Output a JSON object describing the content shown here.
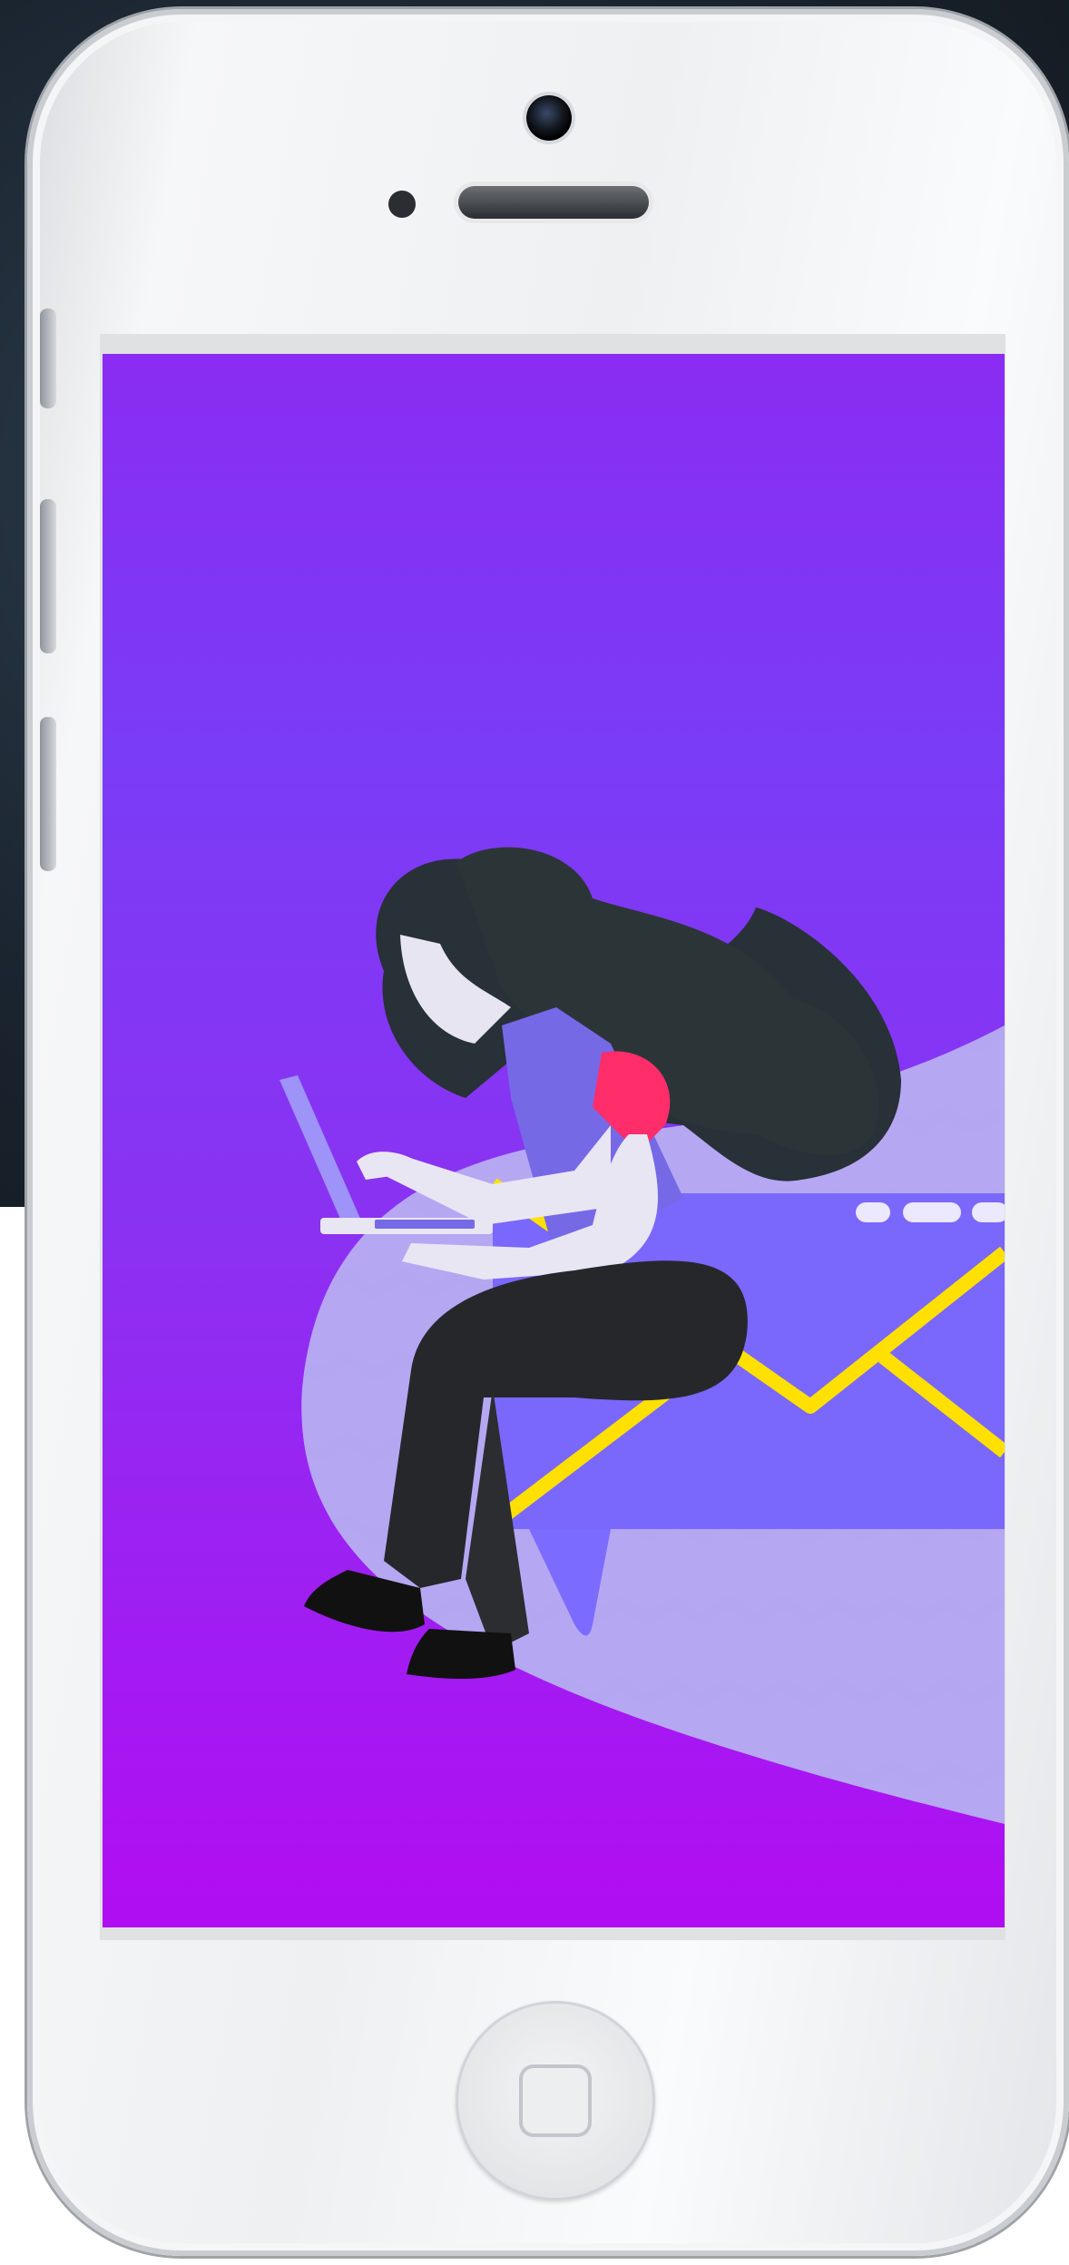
{
  "device": {
    "type": "smartphone",
    "color": "#f2f3f5"
  },
  "screen": {
    "content": "illustration",
    "gradient_top": "#8a2cf3",
    "gradient_bottom": "#b10df2",
    "accent": "#ffe000",
    "icons": [
      "woman-with-laptop-illustration",
      "envelope-icon",
      "chat-bubble-icon",
      "laptop-icon"
    ]
  }
}
